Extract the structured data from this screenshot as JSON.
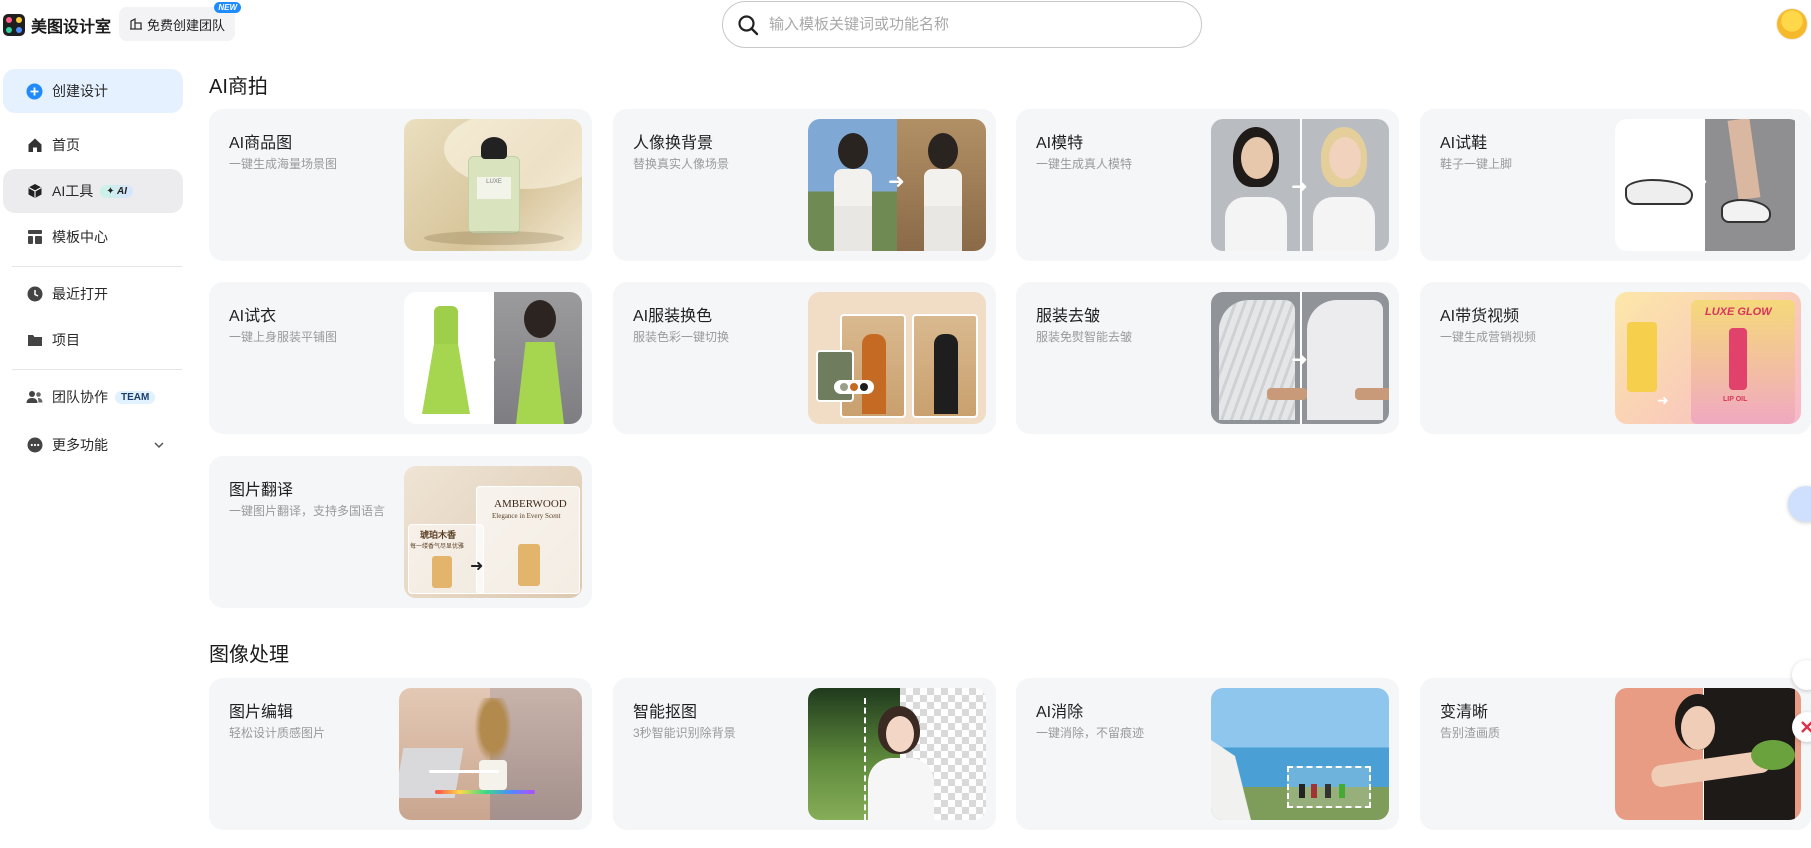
{
  "header": {
    "app_name": "美图设计室",
    "team_button_label": "免费创建团队",
    "team_button_badge": "NEW",
    "search_placeholder": "输入模板关键词或功能名称"
  },
  "sidebar": {
    "create_label": "创建设计",
    "items": [
      {
        "label": "首页",
        "icon": "home-icon"
      },
      {
        "label": "AI工具",
        "icon": "cube-icon",
        "badge": "✦ AI"
      },
      {
        "label": "模板中心",
        "icon": "template-icon"
      },
      {
        "label": "最近打开",
        "icon": "clock-icon"
      },
      {
        "label": "项目",
        "icon": "folder-icon"
      },
      {
        "label": "团队协作",
        "icon": "team-icon",
        "badge": "TEAM"
      },
      {
        "label": "更多功能",
        "icon": "more-icon"
      }
    ]
  },
  "sections": [
    {
      "title": "AI商拍",
      "cards": [
        {
          "title": "AI商品图",
          "subtitle": "一键生成海量场景图"
        },
        {
          "title": "人像换背景",
          "subtitle": "替换真实人像场景"
        },
        {
          "title": "AI模特",
          "subtitle": "一键生成真人模特"
        },
        {
          "title": "AI试鞋",
          "subtitle": "鞋子一键上脚"
        },
        {
          "title": "AI试衣",
          "subtitle": "一键上身服装平铺图"
        },
        {
          "title": "AI服装换色",
          "subtitle": "服装色彩一键切换"
        },
        {
          "title": "服装去皱",
          "subtitle": "服装免熨智能去皱"
        },
        {
          "title": "AI带货视频",
          "subtitle": "一键生成营销视频"
        },
        {
          "title": "图片翻译",
          "subtitle": "一键图片翻译，支持多国语言"
        }
      ]
    },
    {
      "title": "图像处理",
      "cards": [
        {
          "title": "图片编辑",
          "subtitle": "轻松设计质感图片"
        },
        {
          "title": "智能抠图",
          "subtitle": "3秒智能识别除背景"
        },
        {
          "title": "AI消除",
          "subtitle": "一键消除，不留痕迹"
        },
        {
          "title": "变清晰",
          "subtitle": "告别渣画质"
        }
      ]
    }
  ],
  "thumb_text": {
    "perfume_label": "LUXE",
    "amberwood_title": "AMBERWOOD",
    "amberwood_sub": "Elegance in Every Scent",
    "amber_cn": "琥珀木香",
    "amber_cn_sub": "每一缕香气尽显优雅",
    "luxe_glow": "LUXE GLOW",
    "lip_oil": "LIP OIL"
  },
  "colors": {
    "accent_blue": "#1f8bff",
    "create_bg": "#e6f1ff",
    "card_bg": "#f5f6f8"
  }
}
